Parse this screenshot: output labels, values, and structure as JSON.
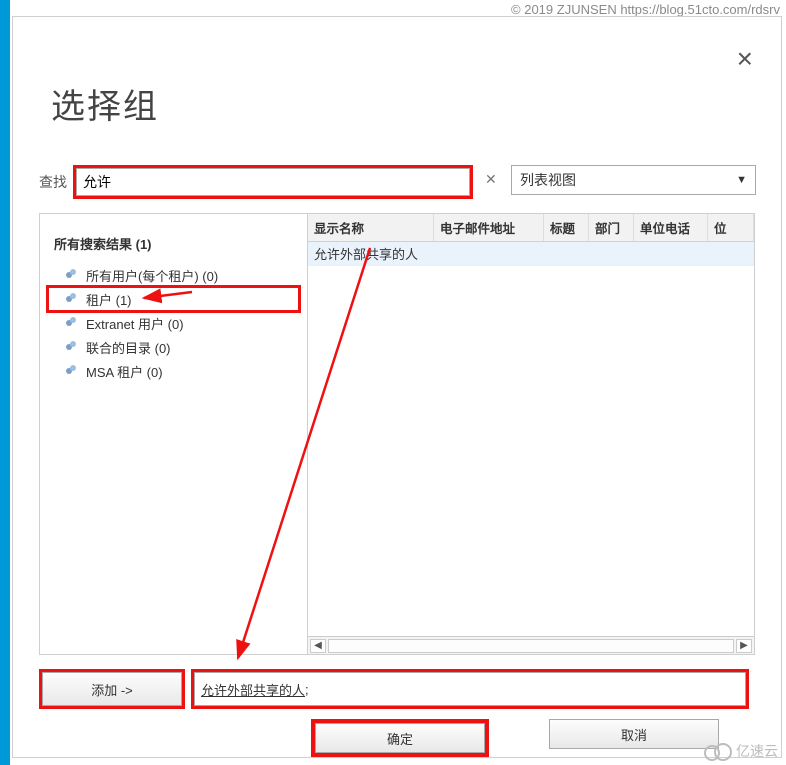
{
  "watermark_top": "© 2019 ZJUNSEN https://blog.51cto.com/rdsrv",
  "watermark_br": "亿速云",
  "dialog": {
    "title": "选择组",
    "close_icon": "×",
    "search": {
      "label": "查找",
      "value": "允许",
      "clear_icon": "✕"
    },
    "view_select": {
      "selected": "列表视图"
    },
    "tree": {
      "title": "所有搜索结果 (1)",
      "items": [
        {
          "label": "所有用户(每个租户) (0)"
        },
        {
          "label": "租户 (1)",
          "selected": true
        },
        {
          "label": "Extranet 用户 (0)"
        },
        {
          "label": "联合的目录 (0)"
        },
        {
          "label": "MSA 租户 (0)"
        }
      ]
    },
    "table": {
      "columns": [
        "显示名称",
        "电子邮件地址",
        "标题",
        "部门",
        "单位电话",
        "位"
      ],
      "rows": [
        {
          "display_name": "允许外部共享的人",
          "selected": true
        }
      ]
    },
    "add_button": "添加 ->",
    "added_text_item": "允许外部共享的人",
    "added_text_sep": ";",
    "ok_button": "确定",
    "cancel_button": "取消"
  }
}
